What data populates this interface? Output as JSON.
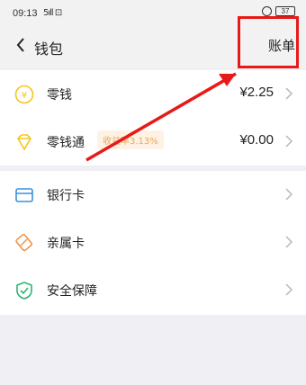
{
  "status": {
    "time": "09:13",
    "signal": "5ıll ⊡",
    "battery": "37"
  },
  "header": {
    "title": "钱包",
    "bill_label": "账单"
  },
  "wallet": {
    "items": [
      {
        "label": "零钱",
        "value": "¥2.25",
        "icon": "yen-coin-icon"
      },
      {
        "label": "零钱通",
        "badge": "收益率3.13%",
        "value": "¥0.00",
        "icon": "diamond-icon"
      }
    ]
  },
  "services": {
    "items": [
      {
        "label": "银行卡",
        "icon": "card-icon"
      },
      {
        "label": "亲属卡",
        "icon": "family-card-icon"
      },
      {
        "label": "安全保障",
        "icon": "shield-icon"
      }
    ]
  },
  "colors": {
    "accent_red": "#e81919",
    "gold": "#f5c518",
    "orange": "#f2934a",
    "blue": "#3a8fe0",
    "green": "#2bb673"
  }
}
